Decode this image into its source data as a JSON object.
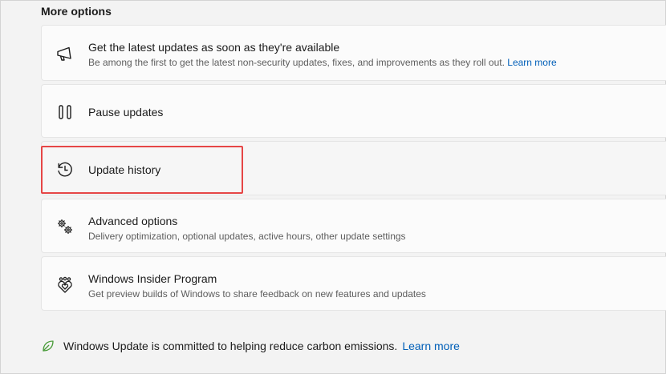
{
  "section": {
    "title": "More options"
  },
  "items": [
    {
      "title": "Get the latest updates as soon as they're available",
      "description": "Be among the first to get the latest non-security updates, fixes, and improvements as they roll out.",
      "link": "Learn more",
      "icon": "megaphone-icon"
    },
    {
      "title": "Pause updates",
      "icon": "pause-icon"
    },
    {
      "title": "Update history",
      "icon": "history-icon"
    },
    {
      "title": "Advanced options",
      "description": "Delivery optimization, optional updates, active hours, other update settings",
      "icon": "gears-icon"
    },
    {
      "title": "Windows Insider Program",
      "description": "Get preview builds of Windows to share feedback on new features and updates",
      "icon": "insider-hearts-icon"
    }
  ],
  "footer": {
    "text": "Windows Update is committed to helping reduce carbon emissions.",
    "link": "Learn more",
    "icon": "leaf-icon"
  },
  "colors": {
    "accent": "#005fb8",
    "highlight": "#e64646",
    "leaf": "#4a9c3a"
  }
}
